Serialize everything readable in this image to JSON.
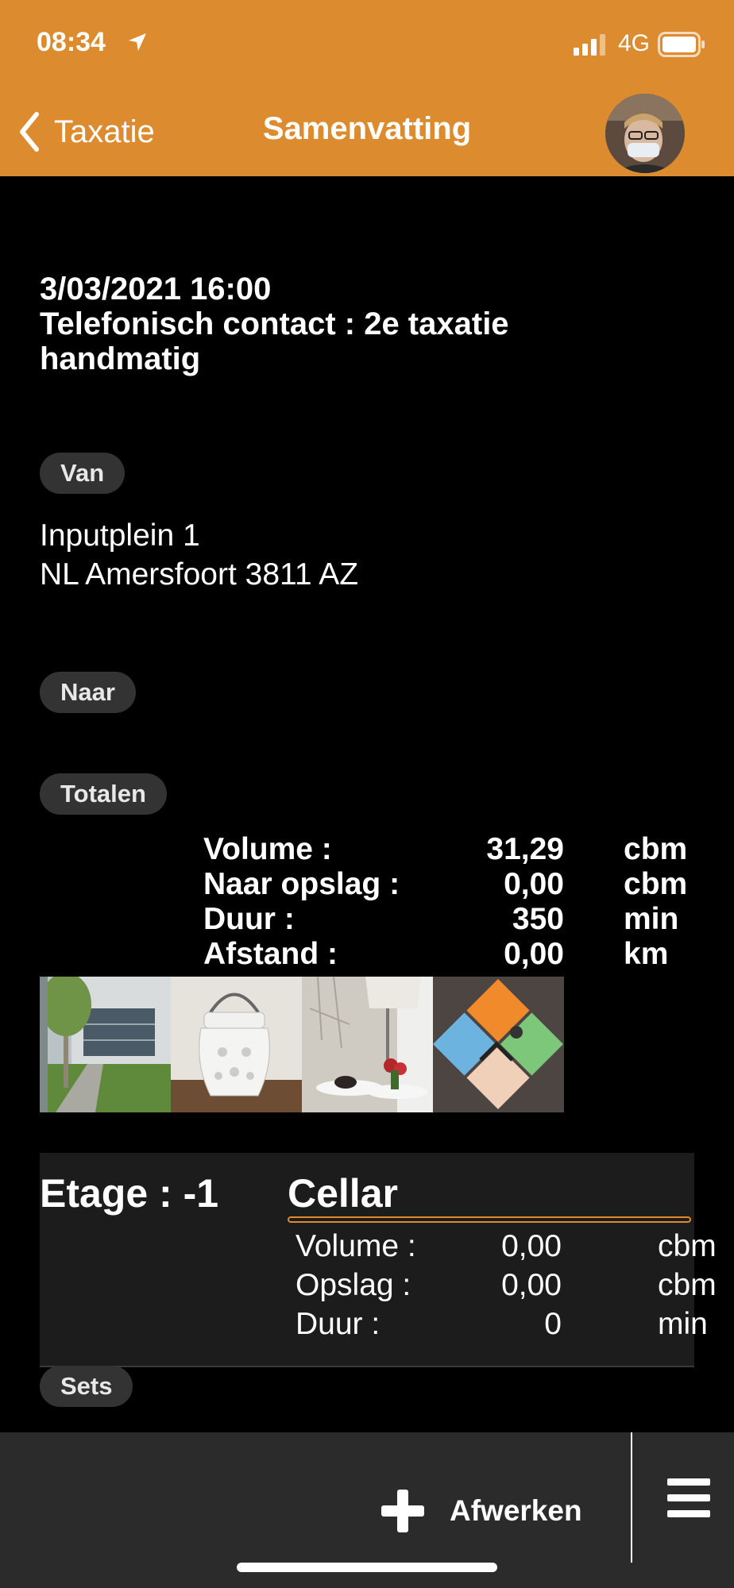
{
  "status_bar": {
    "time": "08:34",
    "network": "4G"
  },
  "nav": {
    "back_label": "Taxatie",
    "title": "Samenvatting"
  },
  "appointment": {
    "datetime": "3/03/2021 16:00",
    "line2": "Telefonisch contact : 2e taxatie",
    "line3": "handmatig"
  },
  "sections": {
    "van": "Van",
    "naar": "Naar",
    "totalen": "Totalen",
    "sets": "Sets"
  },
  "from_address": {
    "line1": "Inputplein 1",
    "line2": "NL Amersfoort 3811 AZ"
  },
  "totals": [
    {
      "label": "Volume :",
      "value": "31,29",
      "unit": "cbm"
    },
    {
      "label": "Naar opslag :",
      "value": "0,00",
      "unit": "cbm"
    },
    {
      "label": "Duur :",
      "value": "350",
      "unit": "min"
    },
    {
      "label": "Afstand :",
      "value": "0,00",
      "unit": "km"
    }
  ],
  "photos": [
    "building-photo",
    "lantern-photo",
    "lamp-table-photo",
    "tile-art-photo"
  ],
  "floor": {
    "label": "Etage : -1",
    "room": "Cellar",
    "stats": [
      {
        "label": "Volume :",
        "value": "0,00",
        "unit": "cbm"
      },
      {
        "label": "Opslag :",
        "value": "0,00",
        "unit": "cbm"
      },
      {
        "label": "Duur :",
        "value": "0",
        "unit": "min"
      }
    ]
  },
  "toolbar": {
    "finish_label": "Afwerken"
  },
  "colors": {
    "accent": "#dd8b2f",
    "background": "#000000",
    "pill": "#333333",
    "panel": "#1c1c1c"
  }
}
